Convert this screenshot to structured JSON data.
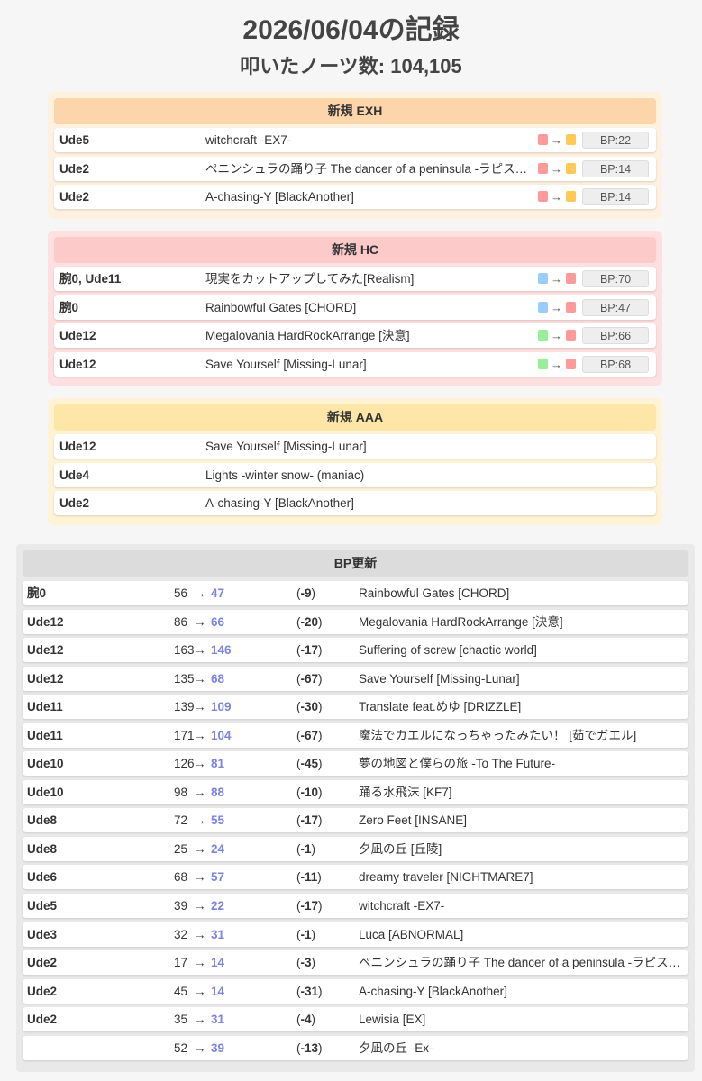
{
  "page": {
    "title": "2026/06/04の記録",
    "notes": "叩いたノーツ数: 104,105"
  },
  "colors": {
    "exh_bg": "#fff1e0",
    "exh_head": "#fcd5aa",
    "hc_bg": "#ffe0e0",
    "hc_head": "#fdcaca",
    "aaa_bg": "#fff3d6",
    "aaa_head": "#fde6a8",
    "lamp_exh": "#ffc857",
    "lamp_hc": "#ff9a9a",
    "lamp_ex": "#99ccff",
    "lamp_clear": "#99ee99"
  },
  "sections": [
    {
      "id": "exh",
      "header": "新規 EXH",
      "rows": [
        {
          "label": "Ude5",
          "song": "witchcraft -EX7-",
          "from": "lamp_hc",
          "arrow": "→",
          "to": "lamp_exh",
          "bp": "BP:22"
        },
        {
          "label": "Ude2",
          "song": "ペニンシュラの踊り子 The dancer of a peninsula -ラピスラズリ-",
          "from": "lamp_hc",
          "arrow": "→",
          "to": "lamp_exh",
          "bp": "BP:14"
        },
        {
          "label": "Ude2",
          "song": "A-chasing-Y [BlackAnother]",
          "from": "lamp_hc",
          "arrow": "→",
          "to": "lamp_exh",
          "bp": "BP:14"
        }
      ]
    },
    {
      "id": "hc",
      "header": "新規 HC",
      "rows": [
        {
          "label": "腕0, Ude11",
          "song": "現実をカットアップしてみた[Realism]",
          "from": "lamp_ex",
          "arrow": "→",
          "to": "lamp_hc",
          "bp": "BP:70"
        },
        {
          "label": "腕0",
          "song": "Rainbowful Gates [CHORD]",
          "from": "lamp_ex",
          "arrow": "→",
          "to": "lamp_hc",
          "bp": "BP:47"
        },
        {
          "label": "Ude12",
          "song": "Megalovania HardRockArrange [決意]",
          "from": "lamp_clear",
          "arrow": "→",
          "to": "lamp_hc",
          "bp": "BP:66"
        },
        {
          "label": "Ude12",
          "song": "Save Yourself [Missing-Lunar]",
          "from": "lamp_clear",
          "arrow": "→",
          "to": "lamp_hc",
          "bp": "BP:68"
        }
      ]
    },
    {
      "id": "aaa",
      "header": "新規 AAA",
      "rows": [
        {
          "label": "Ude12",
          "song": "Save Yourself [Missing-Lunar]"
        },
        {
          "label": "Ude4",
          "song": "Lights -winter snow- (maniac)"
        },
        {
          "label": "Ude2",
          "song": "A-chasing-Y [BlackAnother]"
        }
      ]
    }
  ],
  "bp_update": {
    "header": "BP更新",
    "rows": [
      {
        "label": "腕0",
        "old": "56",
        "arrow": "→",
        "new": "47",
        "diff_open": "(",
        "diff": "-9",
        "diff_close": ")",
        "song": "Rainbowful Gates [CHORD]"
      },
      {
        "label": "Ude12",
        "old": "86",
        "arrow": "→",
        "new": "66",
        "diff_open": "(",
        "diff": "-20",
        "diff_close": ")",
        "song": "Megalovania HardRockArrange [決意]"
      },
      {
        "label": "Ude12",
        "old": "163",
        "arrow": "→",
        "new": "146",
        "diff_open": "(",
        "diff": "-17",
        "diff_close": ")",
        "song": "Suffering of screw [chaotic world]"
      },
      {
        "label": "Ude12",
        "old": "135",
        "arrow": "→",
        "new": "68",
        "diff_open": "(",
        "diff": "-67",
        "diff_close": ")",
        "song": "Save Yourself [Missing-Lunar]"
      },
      {
        "label": "Ude11",
        "old": "139",
        "arrow": "→",
        "new": "109",
        "diff_open": "(",
        "diff": "-30",
        "diff_close": ")",
        "song": "Translate feat.めゆ [DRIZZLE]"
      },
      {
        "label": "Ude11",
        "old": "171",
        "arrow": "→",
        "new": "104",
        "diff_open": "(",
        "diff": "-67",
        "diff_close": ")",
        "song": "魔法でカエルになっちゃったみたい！ [茹でガエル]"
      },
      {
        "label": "Ude10",
        "old": "126",
        "arrow": "→",
        "new": "81",
        "diff_open": "(",
        "diff": "-45",
        "diff_close": ")",
        "song": "夢の地図と僕らの旅 -To The Future-"
      },
      {
        "label": "Ude10",
        "old": "98",
        "arrow": "→",
        "new": "88",
        "diff_open": "(",
        "diff": "-10",
        "diff_close": ")",
        "song": "踊る水飛沫 [KF7]"
      },
      {
        "label": "Ude8",
        "old": "72",
        "arrow": "→",
        "new": "55",
        "diff_open": "(",
        "diff": "-17",
        "diff_close": ")",
        "song": "Zero Feet [INSANE]"
      },
      {
        "label": "Ude8",
        "old": "25",
        "arrow": "→",
        "new": "24",
        "diff_open": "(",
        "diff": "-1",
        "diff_close": ")",
        "song": "夕凪の丘 [丘陵]"
      },
      {
        "label": "Ude6",
        "old": "68",
        "arrow": "→",
        "new": "57",
        "diff_open": "(",
        "diff": "-11",
        "diff_close": ")",
        "song": "dreamy traveler [NIGHTMARE7]"
      },
      {
        "label": "Ude5",
        "old": "39",
        "arrow": "→",
        "new": "22",
        "diff_open": "(",
        "diff": "-17",
        "diff_close": ")",
        "song": "witchcraft -EX7-"
      },
      {
        "label": "Ude3",
        "old": "32",
        "arrow": "→",
        "new": "31",
        "diff_open": "(",
        "diff": "-1",
        "diff_close": ")",
        "song": "Luca [ABNORMAL]"
      },
      {
        "label": "Ude2",
        "old": "17",
        "arrow": "→",
        "new": "14",
        "diff_open": "(",
        "diff": "-3",
        "diff_close": ")",
        "song": "ペニンシュラの踊り子 The dancer of a peninsula -ラピスラズリ-"
      },
      {
        "label": "Ude2",
        "old": "45",
        "arrow": "→",
        "new": "14",
        "diff_open": "(",
        "diff": "-31",
        "diff_close": ")",
        "song": "A-chasing-Y [BlackAnother]"
      },
      {
        "label": "Ude2",
        "old": "35",
        "arrow": "→",
        "new": "31",
        "diff_open": "(",
        "diff": "-4",
        "diff_close": ")",
        "song": "Lewisia [EX]"
      },
      {
        "label": "",
        "old": "52",
        "arrow": "→",
        "new": "39",
        "diff_open": "(",
        "diff": "-13",
        "diff_close": ")",
        "song": "夕凪の丘 -Ex-"
      }
    ]
  }
}
